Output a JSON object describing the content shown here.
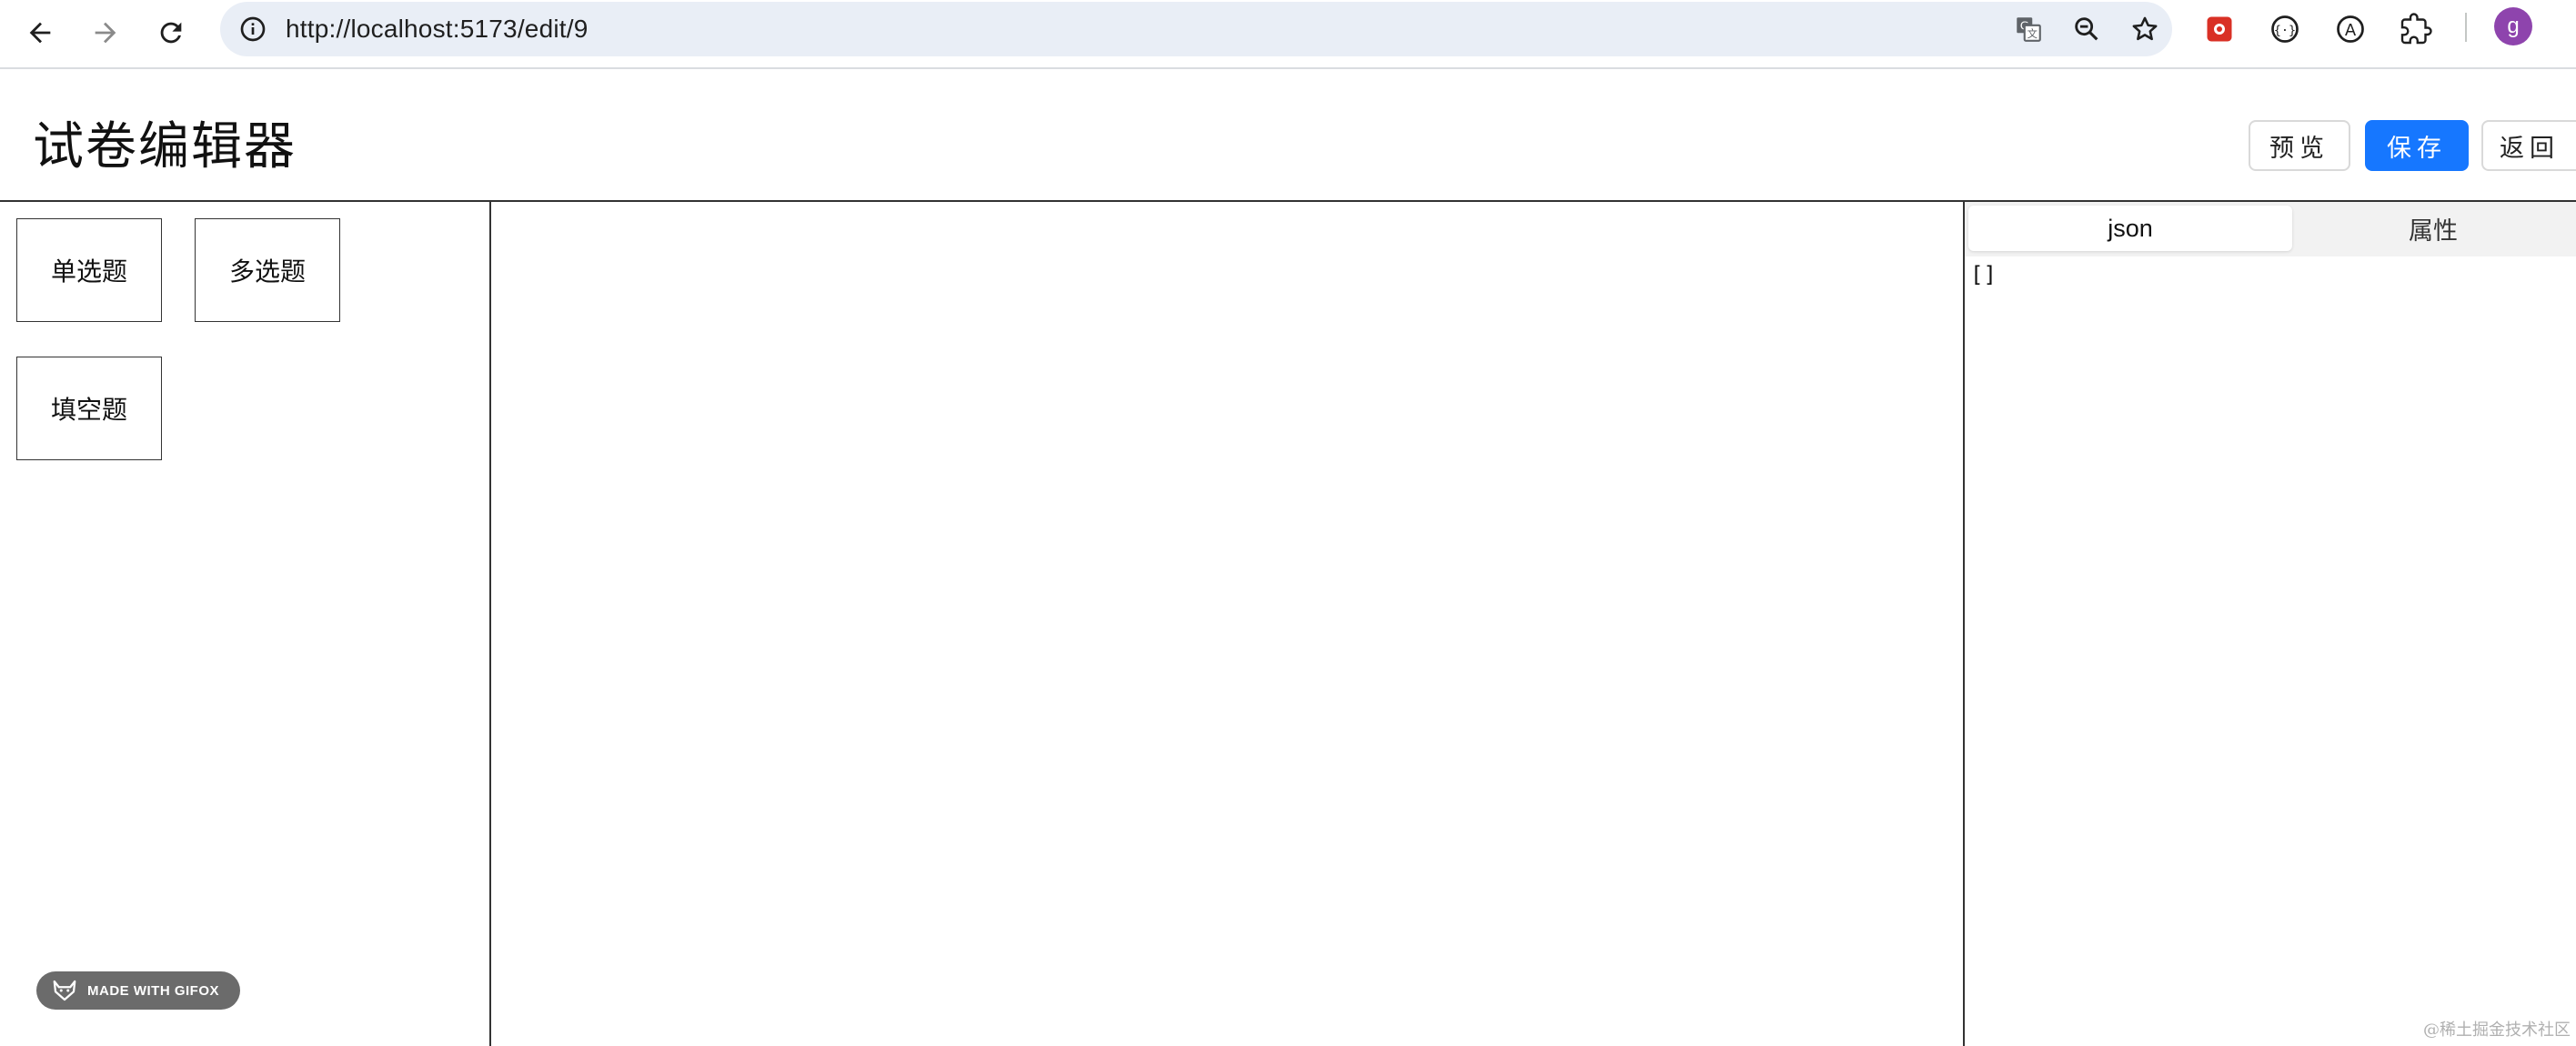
{
  "browser": {
    "url": "http://localhost:5173/edit/9",
    "avatar_letter": "g",
    "icons": [
      "back-icon",
      "forward-icon",
      "reload-icon",
      "site-info-icon",
      "translate-icon",
      "zoom-out-icon",
      "bookmark-star-icon",
      "extension-red-icon",
      "extension-bracket-icon",
      "extension-a-icon",
      "extensions-puzzle-icon"
    ]
  },
  "header": {
    "title": "试卷编辑器",
    "buttons": {
      "preview": "预览",
      "save": "保存",
      "back": "返回"
    },
    "accent_color": "#1677ff"
  },
  "left_panel": {
    "question_types": [
      "单选题",
      "多选题",
      "填空题"
    ]
  },
  "right_panel": {
    "tabs": [
      "json",
      "属性"
    ],
    "active_tab": "json",
    "json_content": "[]"
  },
  "overlays": {
    "gifox_badge": "MADE WITH GIFOX",
    "watermark": "@稀土掘金技术社区"
  }
}
